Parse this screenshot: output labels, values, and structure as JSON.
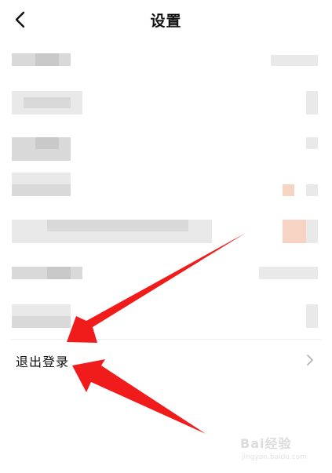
{
  "header": {
    "title": "设置",
    "back_icon": "chevron-left-icon"
  },
  "logout": {
    "label": "退出登录",
    "chevron_icon": "chevron-right-icon"
  },
  "annotations": {
    "arrow_color": "#f01c1c",
    "arrow_count": 2
  },
  "watermark": {
    "brand": "Bai经验",
    "url": "jingyan.baidu.com"
  },
  "colors": {
    "background": "#ffffff",
    "redacted_gray": "#d9d9d9",
    "redacted_orange": "#f6d3c2"
  }
}
